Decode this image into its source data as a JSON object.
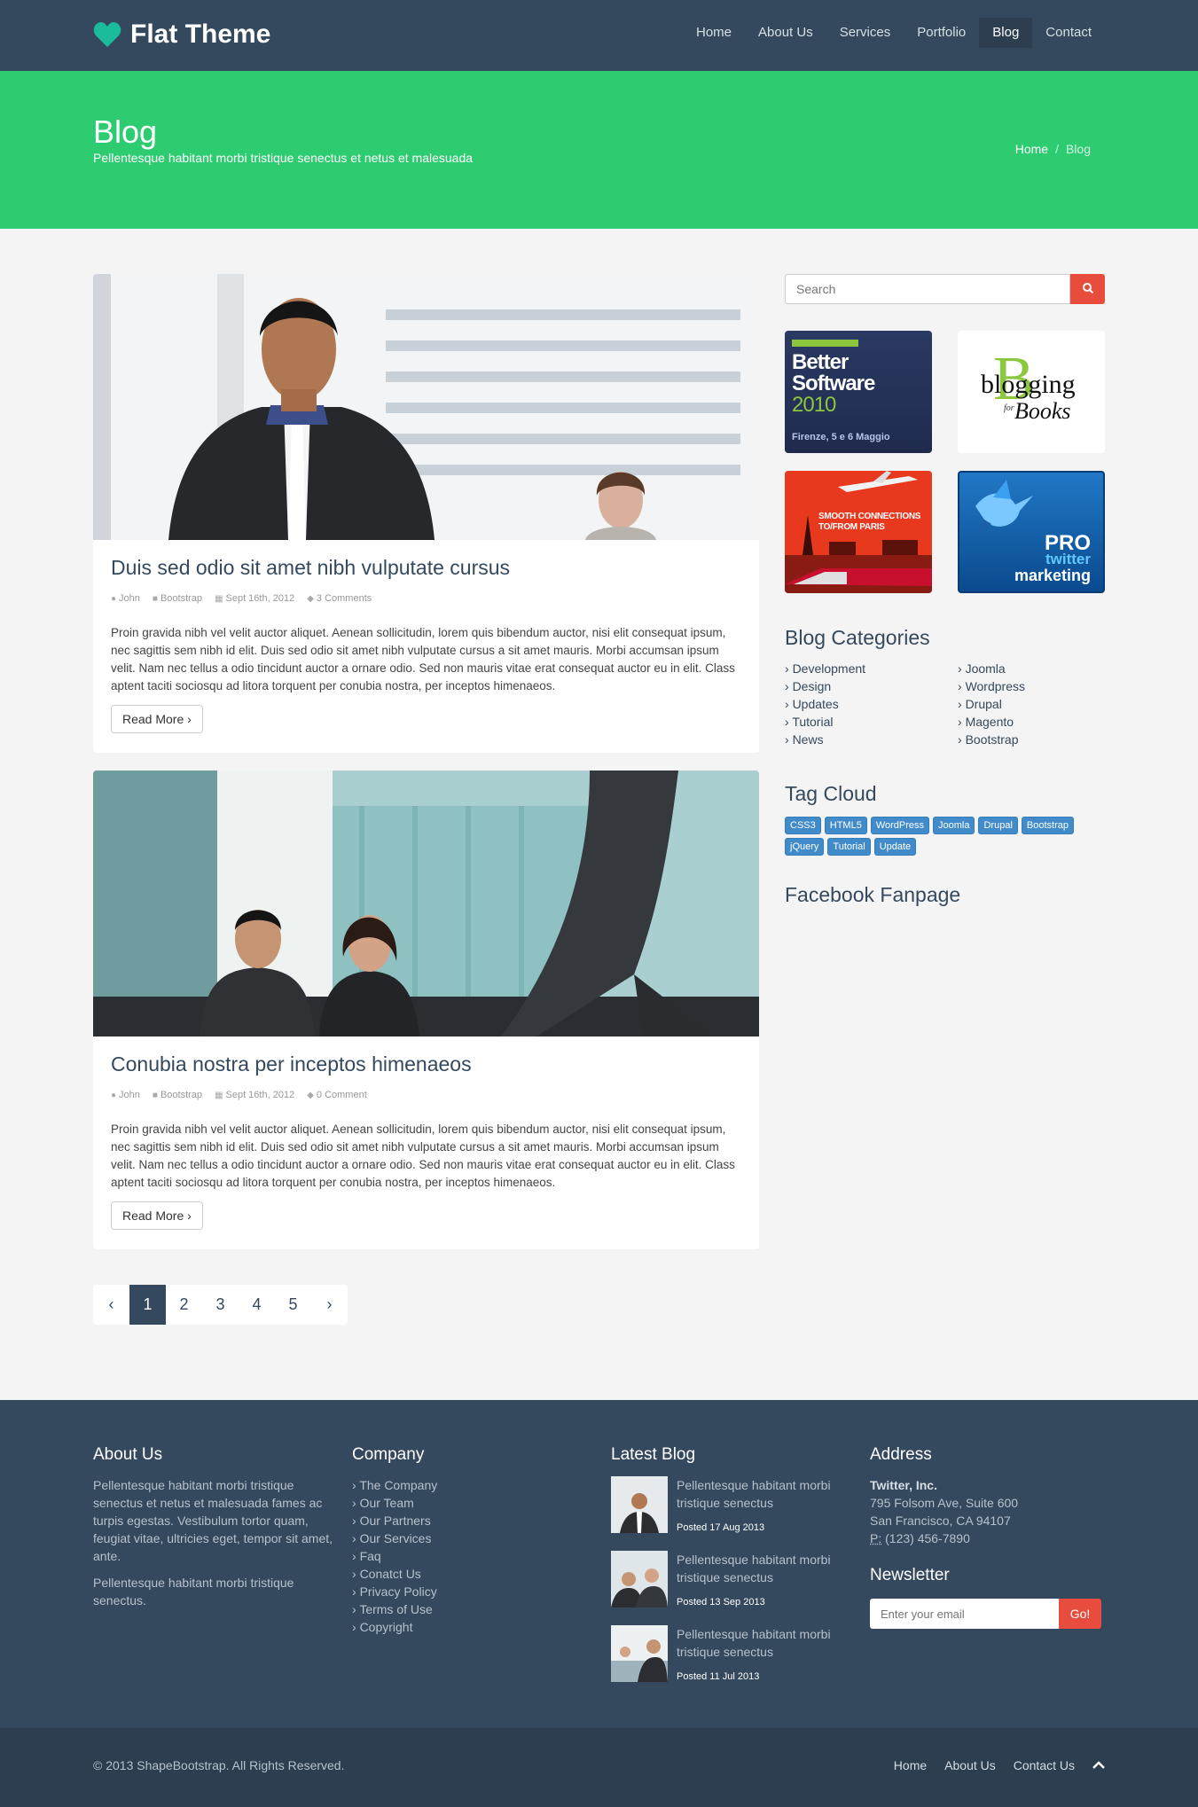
{
  "brand": {
    "name": "Flat Theme"
  },
  "nav": [
    {
      "label": "Home"
    },
    {
      "label": "About Us"
    },
    {
      "label": "Services"
    },
    {
      "label": "Portfolio"
    },
    {
      "label": "Blog"
    },
    {
      "label": "Contact"
    }
  ],
  "title": {
    "heading": "Blog",
    "subtitle": "Pellentesque habitant morbi tristique senectus et netus et malesuada"
  },
  "breadcrumb": {
    "home": "Home",
    "separator": "/",
    "current": "Blog"
  },
  "posts": [
    {
      "title": "Duis sed odio sit amet nibh vulputate cursus",
      "author": "John",
      "category": "Bootstrap",
      "date": "Sept 16th, 2012",
      "comments": "3 Comments",
      "body": "Proin gravida nibh vel velit auctor aliquet. Aenean sollicitudin, lorem quis bibendum auctor, nisi elit consequat ipsum, nec sagittis sem nibh id elit. Duis sed odio sit amet nibh vulputate cursus a sit amet mauris. Morbi accumsan ipsum velit. Nam nec tellus a odio tincidunt auctor a ornare odio. Sed non mauris vitae erat consequat auctor eu in elit. Class aptent taciti sociosqu ad litora torquent per conubia nostra, per inceptos himenaeos.",
      "read_more": "Read More ›"
    },
    {
      "title": "Conubia nostra per inceptos himenaeos",
      "author": "John",
      "category": "Bootstrap",
      "date": "Sept 16th, 2012",
      "comments": "0 Comment",
      "body": "Proin gravida nibh vel velit auctor aliquet. Aenean sollicitudin, lorem quis bibendum auctor, nisi elit consequat ipsum, nec sagittis sem nibh id elit. Duis sed odio sit amet nibh vulputate cursus a sit amet mauris. Morbi accumsan ipsum velit. Nam nec tellus a odio tincidunt auctor a ornare odio. Sed non mauris vitae erat consequat auctor eu in elit. Class aptent taciti sociosqu ad litora torquent per conubia nostra, per inceptos himenaeos.",
      "read_more": "Read More ›"
    }
  ],
  "pagination": {
    "prev": "‹",
    "pages": [
      "1",
      "2",
      "3",
      "4",
      "5"
    ],
    "next": "›",
    "current": "1"
  },
  "sidebar": {
    "search_placeholder": "Search",
    "ads": {
      "ad1_line1": "Better",
      "ad1_line2": "Software",
      "ad1_line3": "2010",
      "ad1_line4": "Firenze, 5 e 6 Maggio",
      "ad2_line1": "blogging",
      "ad2_line2": "for",
      "ad2_line3": "Books",
      "ad3_line1": "SMOOTH CONNECTIONS",
      "ad3_line2": "TO/FROM PARIS",
      "ad4_line1": "PRO",
      "ad4_line2": "twitter",
      "ad4_line3": "marketing"
    },
    "categories_title": "Blog Categories",
    "categories_left": [
      "Development",
      "Design",
      "Updates",
      "Tutorial",
      "News"
    ],
    "categories_right": [
      "Joomla",
      "Wordpress",
      "Drupal",
      "Magento",
      "Bootstrap"
    ],
    "tag_title": "Tag Cloud",
    "tags": [
      "CSS3",
      "HTML5",
      "WordPress",
      "Joomla",
      "Drupal",
      "Bootstrap",
      "jQuery",
      "Tutorial",
      "Update"
    ],
    "facebook_title": "Facebook Fanpage"
  },
  "footer": {
    "about_title": "About Us",
    "about_p1": "Pellentesque habitant morbi tristique senectus et netus et malesuada fames ac turpis egestas. Vestibulum tortor quam, feugiat vitae, ultricies eget, tempor sit amet, ante.",
    "about_p2": "Pellentesque habitant morbi tristique senectus.",
    "company_title": "Company",
    "company_links": [
      "The Company",
      "Our Team",
      "Our Partners",
      "Our Services",
      "Faq",
      "Conatct Us",
      "Privacy Policy",
      "Terms of Use",
      "Copyright"
    ],
    "latest_title": "Latest Blog",
    "latest": [
      {
        "title": "Pellentesque habitant morbi tristique senectus",
        "date": "Posted 17 Aug 2013"
      },
      {
        "title": "Pellentesque habitant morbi tristique senectus",
        "date": "Posted 13 Sep 2013"
      },
      {
        "title": "Pellentesque habitant morbi tristique senectus",
        "date": "Posted 11 Jul 2013"
      }
    ],
    "address_title": "Address",
    "company_name": "Twitter, Inc.",
    "street": "795 Folsom Ave, Suite 600",
    "city": "San Francisco, CA 94107",
    "phone_label": "P:",
    "phone": "(123) 456-7890",
    "newsletter_title": "Newsletter",
    "newsletter_placeholder": "Enter your email",
    "newsletter_button": "Go!",
    "copyright": "© 2013 ShapeBootstrap. All Rights Reserved.",
    "bottom_links": [
      "Home",
      "About Us",
      "Contact Us"
    ]
  },
  "colors": {
    "navy": "#34495e",
    "green": "#2ecc71",
    "red": "#e74c3c",
    "tag_blue": "#428bca"
  }
}
